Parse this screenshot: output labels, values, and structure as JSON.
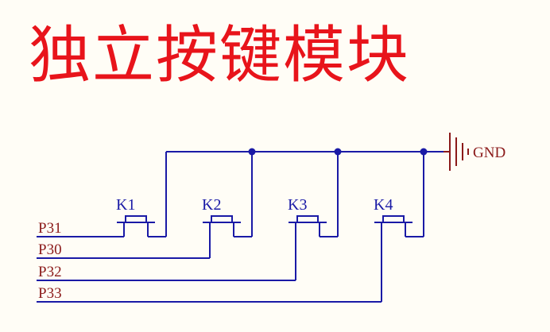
{
  "title": "独立按键模块",
  "ground_label": "GND",
  "keys": [
    {
      "label": "K1"
    },
    {
      "label": "K2"
    },
    {
      "label": "K3"
    },
    {
      "label": "K4"
    }
  ],
  "ports": [
    {
      "label": "P31"
    },
    {
      "label": "P30"
    },
    {
      "label": "P32"
    },
    {
      "label": "P33"
    }
  ],
  "colors": {
    "title": "#e8141b",
    "wire": "#1a1aa6",
    "ground": "#8b1a1a",
    "port_label": "#8b1a1a",
    "background": "#fffdf6"
  }
}
